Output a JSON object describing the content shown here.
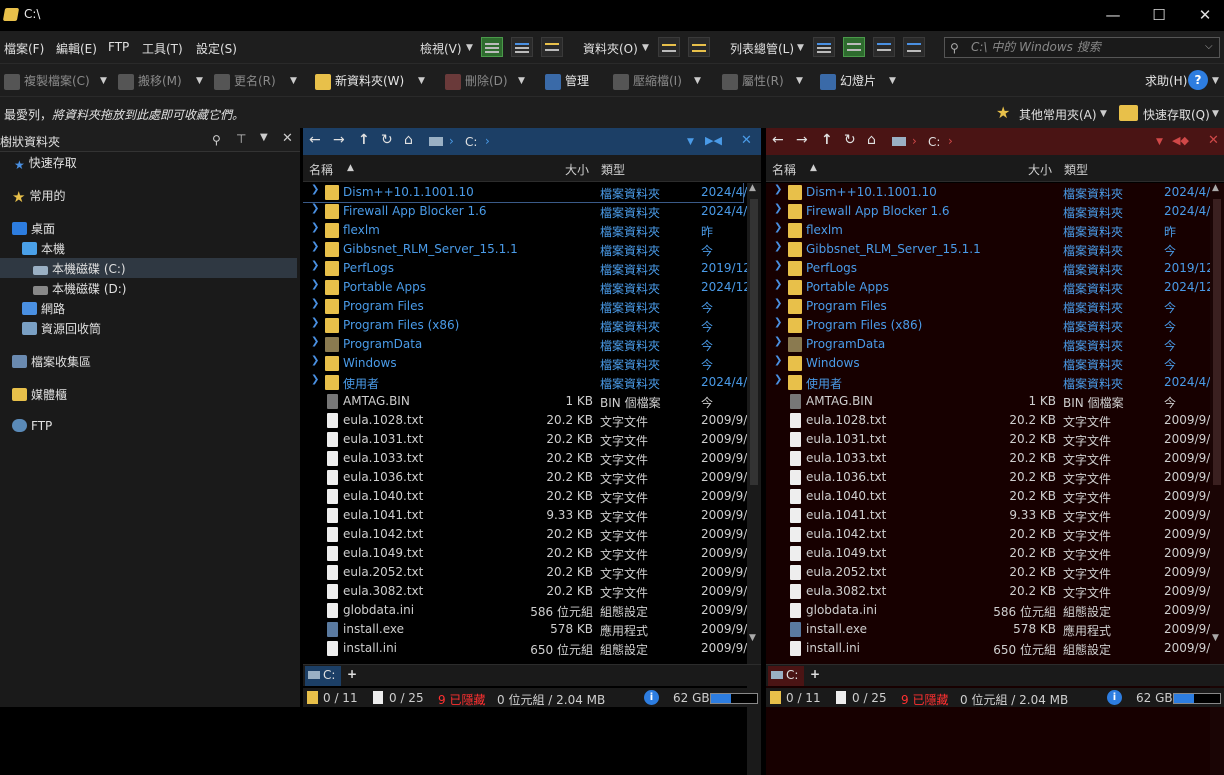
{
  "window": {
    "title": "C:\\",
    "minimize": "—",
    "maximize": "☐",
    "close": "✕"
  },
  "menu": {
    "items": [
      "檔案(F)",
      "編輯(E)",
      "FTP",
      "工具(T)",
      "設定(S)"
    ],
    "view": "檢視(V)",
    "folders": "資料夾(O)",
    "listmgr": "列表總管(L)",
    "search_placeholder": "C:\\ 中的 Windows 搜索"
  },
  "toolbar": {
    "copy": "複製檔案(C)",
    "move": "搬移(M)",
    "rename": "更名(R)",
    "newfolder": "新資料夾(W)",
    "delete": "刪除(D)",
    "manage": "管理",
    "compress": "壓縮檔(I)",
    "properties": "屬性(R)",
    "slideshow": "幻燈片",
    "help": "求助(H)"
  },
  "favbar": {
    "prefix": "最愛列，",
    "hint": "將資料夾拖放到此處即可收藏它們。",
    "others": "其他常用夾(A)",
    "quick": "快速存取(Q)"
  },
  "tree": {
    "header": "樹狀資料夾",
    "items": [
      "快速存取",
      "常用的",
      "桌面",
      "本機",
      "本機磁碟 (C:)",
      "本機磁碟 (D:)",
      "網路",
      "資源回收筒",
      "檔案收集區",
      "媒體櫃",
      "FTP"
    ]
  },
  "pane": {
    "path": "C:",
    "col_name": "名稱",
    "col_size": "大小",
    "col_type": "類型",
    "rows": [
      {
        "name": "Dism++10.1.1001.10",
        "size": "",
        "type": "檔案資料夾",
        "date": "2024/4/",
        "kind": "folder"
      },
      {
        "name": "Firewall App Blocker 1.6",
        "size": "",
        "type": "檔案資料夾",
        "date": "2024/4/",
        "kind": "folder"
      },
      {
        "name": "flexlm",
        "size": "",
        "type": "檔案資料夾",
        "date": "昨",
        "kind": "folder"
      },
      {
        "name": "Gibbsnet_RLM_Server_15.1.1",
        "size": "",
        "type": "檔案資料夾",
        "date": "今",
        "kind": "folder"
      },
      {
        "name": "PerfLogs",
        "size": "",
        "type": "檔案資料夾",
        "date": "2019/12",
        "kind": "folder"
      },
      {
        "name": "Portable Apps",
        "size": "",
        "type": "檔案資料夾",
        "date": "2024/12",
        "kind": "folder"
      },
      {
        "name": "Program Files",
        "size": "",
        "type": "檔案資料夾",
        "date": "今",
        "kind": "folder"
      },
      {
        "name": "Program Files (x86)",
        "size": "",
        "type": "檔案資料夾",
        "date": "今",
        "kind": "folder"
      },
      {
        "name": "ProgramData",
        "size": "",
        "type": "檔案資料夾",
        "date": "今",
        "kind": "folder"
      },
      {
        "name": "Windows",
        "size": "",
        "type": "檔案資料夾",
        "date": "今",
        "kind": "folder"
      },
      {
        "name": "使用者",
        "size": "",
        "type": "檔案資料夾",
        "date": "2024/4/",
        "kind": "folder"
      },
      {
        "name": "AMTAG.BIN",
        "size": "1 KB",
        "type": "BIN 個檔案",
        "date": "今",
        "kind": "file"
      },
      {
        "name": "eula.1028.txt",
        "size": "20.2 KB",
        "type": "文字文件",
        "date": "2009/9/",
        "kind": "file"
      },
      {
        "name": "eula.1031.txt",
        "size": "20.2 KB",
        "type": "文字文件",
        "date": "2009/9/",
        "kind": "file"
      },
      {
        "name": "eula.1033.txt",
        "size": "20.2 KB",
        "type": "文字文件",
        "date": "2009/9/",
        "kind": "file"
      },
      {
        "name": "eula.1036.txt",
        "size": "20.2 KB",
        "type": "文字文件",
        "date": "2009/9/",
        "kind": "file"
      },
      {
        "name": "eula.1040.txt",
        "size": "20.2 KB",
        "type": "文字文件",
        "date": "2009/9/",
        "kind": "file"
      },
      {
        "name": "eula.1041.txt",
        "size": "9.33 KB",
        "type": "文字文件",
        "date": "2009/9/",
        "kind": "file"
      },
      {
        "name": "eula.1042.txt",
        "size": "20.2 KB",
        "type": "文字文件",
        "date": "2009/9/",
        "kind": "file"
      },
      {
        "name": "eula.1049.txt",
        "size": "20.2 KB",
        "type": "文字文件",
        "date": "2009/9/",
        "kind": "file"
      },
      {
        "name": "eula.2052.txt",
        "size": "20.2 KB",
        "type": "文字文件",
        "date": "2009/9/",
        "kind": "file"
      },
      {
        "name": "eula.3082.txt",
        "size": "20.2 KB",
        "type": "文字文件",
        "date": "2009/9/",
        "kind": "file"
      },
      {
        "name": "globdata.ini",
        "size": "586 位元組",
        "type": "組態設定",
        "date": "2009/9/",
        "kind": "file"
      },
      {
        "name": "install.exe",
        "size": "578 KB",
        "type": "應用程式",
        "date": "2009/9/",
        "kind": "file"
      },
      {
        "name": "install.ini",
        "size": "650 位元組",
        "type": "組態設定",
        "date": "2009/9/",
        "kind": "file"
      }
    ],
    "tab": "C:",
    "tab_add": "+",
    "status": {
      "folders": "0 / 11",
      "files": "0 / 25",
      "hidden": "9 已隱藏",
      "size": "0 位元組 / 2.04 MB",
      "free": "62 GB"
    }
  },
  "colors": {
    "left_addr": "#1c3f66",
    "right_addr": "#4a1414",
    "right_list": "#170000",
    "folder_text": "#4a9be8",
    "hidden_text": "#ff3030"
  }
}
